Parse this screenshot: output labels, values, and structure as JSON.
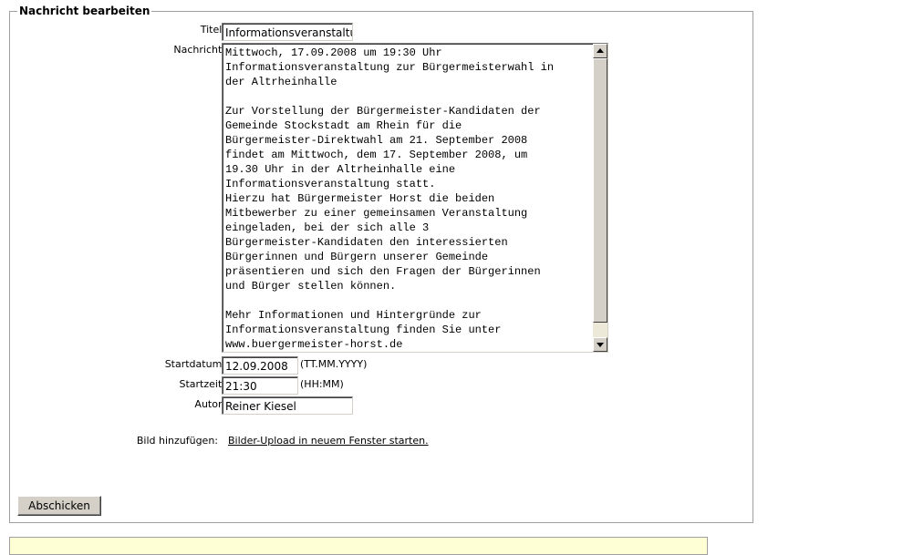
{
  "form": {
    "legend": "Nachricht bearbeiten",
    "titel_label": "Titel:",
    "titel_value": "Informationsveranstaltung",
    "nachricht_label": "Nachricht:",
    "nachricht_lines": [
      "Mittwoch, 17.09.2008 um 19:30 Uhr",
      "Informationsveranstaltung zur Bürgermeisterwahl in",
      "der Altrheinhalle",
      "",
      "Zur Vorstellung der Bürgermeister-Kandidaten der",
      "Gemeinde Stockstadt am Rhein für die",
      "Bürgermeister-Direktwahl am 21. September 2008",
      "findet am Mittwoch, dem 17. September 2008, um",
      "19.30 Uhr in der Altrheinhalle eine",
      "Informationsveranstaltung statt.",
      "Hierzu hat Bürgermeister Horst die beiden",
      "Mitbewerber zu einer gemeinsamen Veranstaltung",
      "eingeladen, bei der sich alle 3",
      "Bürgermeister-Kandidaten den interessierten",
      "Bürgerinnen und Bürgern unserer Gemeinde",
      "präsentieren und sich den Fragen der Bürgerinnen",
      "und Bürger stellen können.",
      "",
      "Mehr Informationen und Hintergründe zur",
      "Informationsveranstaltung finden Sie unter",
      "www.buergermeister-horst.de"
    ],
    "startdatum_label": "Startdatum:",
    "startdatum_value": "12.09.2008",
    "startdatum_hint": "(TT.MM.YYYY)",
    "startzeit_label": "Startzeit:",
    "startzeit_value": "21:30",
    "startzeit_hint": "(HH:MM)",
    "autor_label": "Autor:",
    "autor_value": "Reiner Kiesel",
    "bild_label": "Bild hinzufügen:",
    "bild_link": "Bilder-Upload in neuem Fenster starten.",
    "submit_label": "Abschicken"
  }
}
